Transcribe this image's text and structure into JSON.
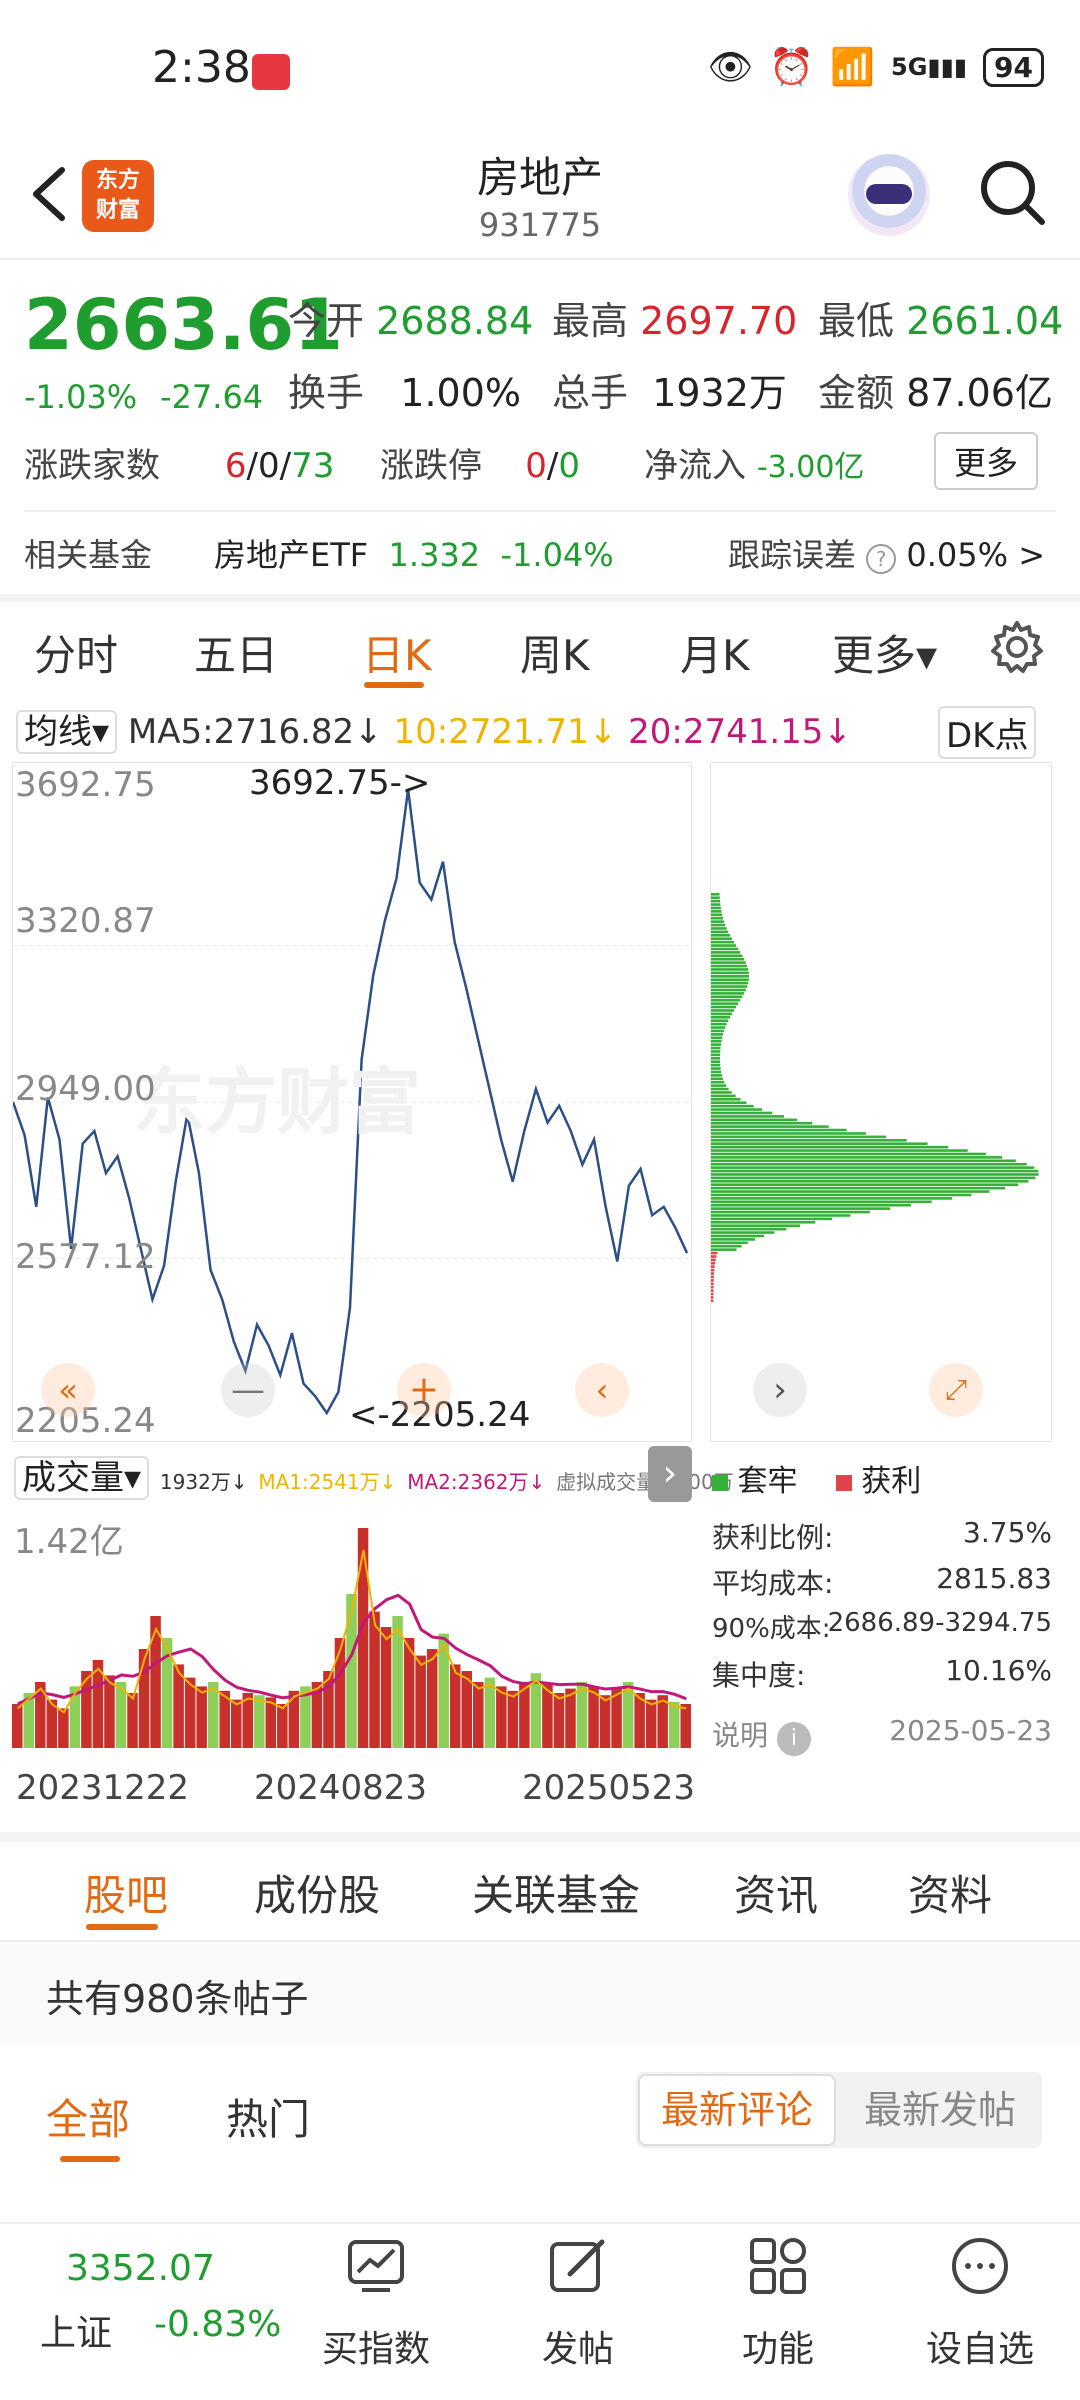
{
  "status": {
    "time": "2:38",
    "battery": "94",
    "net": "5G"
  },
  "header": {
    "title": "房地产",
    "code": "931775",
    "logo_lines": [
      "东方",
      "财富"
    ]
  },
  "quote": {
    "price": "2663.61",
    "pct": "-1.03%",
    "chg": "-27.64",
    "open_label": "今开",
    "open": "2688.84",
    "high_label": "最高",
    "high": "2697.70",
    "low_label": "最低",
    "low": "2661.04",
    "turnover_label": "换手",
    "turnover": "1.00%",
    "volume_label": "总手",
    "volume": "1932万",
    "amount_label": "金额",
    "amount": "87.06亿",
    "updown_label": "涨跌家数",
    "up": "6",
    "flat": "0",
    "down": "73",
    "limit_label": "涨跌停",
    "limit_up": "0",
    "limit_down": "0",
    "netflow_label": "净流入",
    "netflow": "-3.00亿",
    "more": "更多",
    "fund_label": "相关基金",
    "fund_name": "房地产ETF",
    "fund_price": "1.332",
    "fund_pct": "-1.04%",
    "track_label": "跟踪误差",
    "track_value": "0.05% >"
  },
  "ktabs": [
    "分时",
    "五日",
    "日K",
    "周K",
    "月K",
    "更多▾"
  ],
  "ma": {
    "selector": "均线▾",
    "ma5": "MA5:2716.82↓",
    "ma10": "10:2721.71↓",
    "ma20": "20:2741.15↓",
    "dk": "DK点"
  },
  "chart_data": {
    "type": "line",
    "title": "",
    "ylabels": [
      "3692.75",
      "3320.87",
      "2949.00",
      "2577.12",
      "2205.24"
    ],
    "max_label": "3692.75->",
    "min_label": "<-2205.24",
    "watermark": "东方财富",
    "x": [
      "20231222",
      "20240823",
      "20250523"
    ],
    "series": [
      {
        "values": [
          2949,
          2870,
          2700,
          2960,
          2860,
          2600,
          2850,
          2880,
          2780,
          2820,
          2720,
          2600,
          2480,
          2560,
          2760,
          2920,
          2780,
          2550,
          2480,
          2380,
          2310,
          2420,
          2370,
          2300,
          2400,
          2280,
          2250,
          2210,
          2260,
          2460,
          3050,
          3250,
          3380,
          3480,
          3692,
          3470,
          3430,
          3520,
          3330,
          3220,
          3100,
          2980,
          2860,
          2760,
          2880,
          2980,
          2900,
          2940,
          2880,
          2800,
          2860,
          2700,
          2570,
          2750,
          2790,
          2680,
          2700,
          2650,
          2590
        ]
      }
    ],
    "ylim": [
      2205.24,
      3692.75
    ]
  },
  "volume": {
    "selector": "成交量▾",
    "vol": "1932万↓",
    "ma1": "MA1:2541万↓",
    "ma2": "MA2:2362万↓",
    "virtual": "虚拟成交量:2200万",
    "ylabel": "1.42亿",
    "bars": [
      0.2,
      0.25,
      0.3,
      0.22,
      0.18,
      0.28,
      0.35,
      0.4,
      0.33,
      0.3,
      0.25,
      0.45,
      0.6,
      0.5,
      0.38,
      0.32,
      0.28,
      0.3,
      0.26,
      0.22,
      0.25,
      0.24,
      0.23,
      0.2,
      0.26,
      0.28,
      0.3,
      0.35,
      0.5,
      0.7,
      1.0,
      0.62,
      0.55,
      0.6,
      0.5,
      0.42,
      0.45,
      0.52,
      0.38,
      0.35,
      0.3,
      0.32,
      0.28,
      0.26,
      0.3,
      0.34,
      0.29,
      0.25,
      0.27,
      0.3,
      0.28,
      0.24,
      0.27,
      0.3,
      0.25,
      0.22,
      0.24,
      0.21,
      0.2
    ]
  },
  "dist": {
    "legend_trapped": "套牢",
    "legend_profit": "获利",
    "profit_ratio_label": "获利比例:",
    "profit_ratio": "3.75%",
    "avg_cost_label": "平均成本:",
    "avg_cost": "2815.83",
    "cost90_label": "90%成本:",
    "cost90": "2686.89-3294.75",
    "concentration_label": "集中度:",
    "concentration": "10.16%",
    "note_label": "说明",
    "date": "2025-05-23"
  },
  "btabs": [
    "股吧",
    "成份股",
    "关联基金",
    "资讯",
    "资料"
  ],
  "posts": {
    "count_text": "共有980条帖子",
    "filter_all": "全部",
    "filter_hot": "热门",
    "sort_latest_comment": "最新评论",
    "sort_latest_post": "最新发帖"
  },
  "bottombar": {
    "index_value": "3352.07",
    "index_name": "上证",
    "index_pct": "-0.83%",
    "buy_index": "买指数",
    "post": "发帖",
    "func": "功能",
    "watchlist": "设自选"
  },
  "colors": {
    "up": "#d6252b",
    "down": "#1f9d2e",
    "accent": "#e26a12",
    "line": "#2c4f86"
  }
}
